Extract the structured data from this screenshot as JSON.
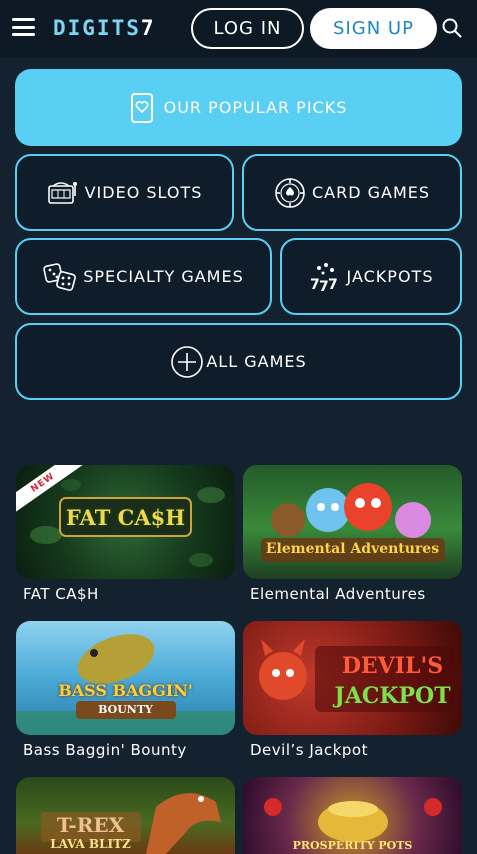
{
  "header": {
    "logo_text": "DIGITS",
    "logo_number": "7",
    "login_label": "LOG IN",
    "signup_label": "SIGN UP"
  },
  "categories": {
    "popular": "OUR POPULAR PICKS",
    "video_slots": "VIDEO SLOTS",
    "card_games": "CARD GAMES",
    "specialty_games": "SPECIALTY GAMES",
    "jackpots": "JACKPOTS",
    "all_games": "ALL GAMES"
  },
  "games": [
    {
      "title": "FAT CA$H",
      "art_text": "FAT CA$H",
      "badge": "NEW"
    },
    {
      "title": "Elemental Adventures",
      "art_text": "Elemental Adventures"
    },
    {
      "title": "Bass Baggin' Bounty",
      "art_text": "BASS BAGGIN'",
      "art_subtext": "BOUNTY"
    },
    {
      "title": "Devil’s Jackpot",
      "art_text": "DEVIL'S",
      "art_subtext": "JACKPOT"
    },
    {
      "title": "",
      "art_text": "T-REX",
      "art_subtext": "LAVA BLITZ"
    },
    {
      "title": "",
      "art_text": "PROSPERITY POTS"
    }
  ],
  "colors": {
    "accent": "#59cff4",
    "background": "#142230",
    "header": "#0d1924",
    "signup_text": "#1d87c4"
  }
}
